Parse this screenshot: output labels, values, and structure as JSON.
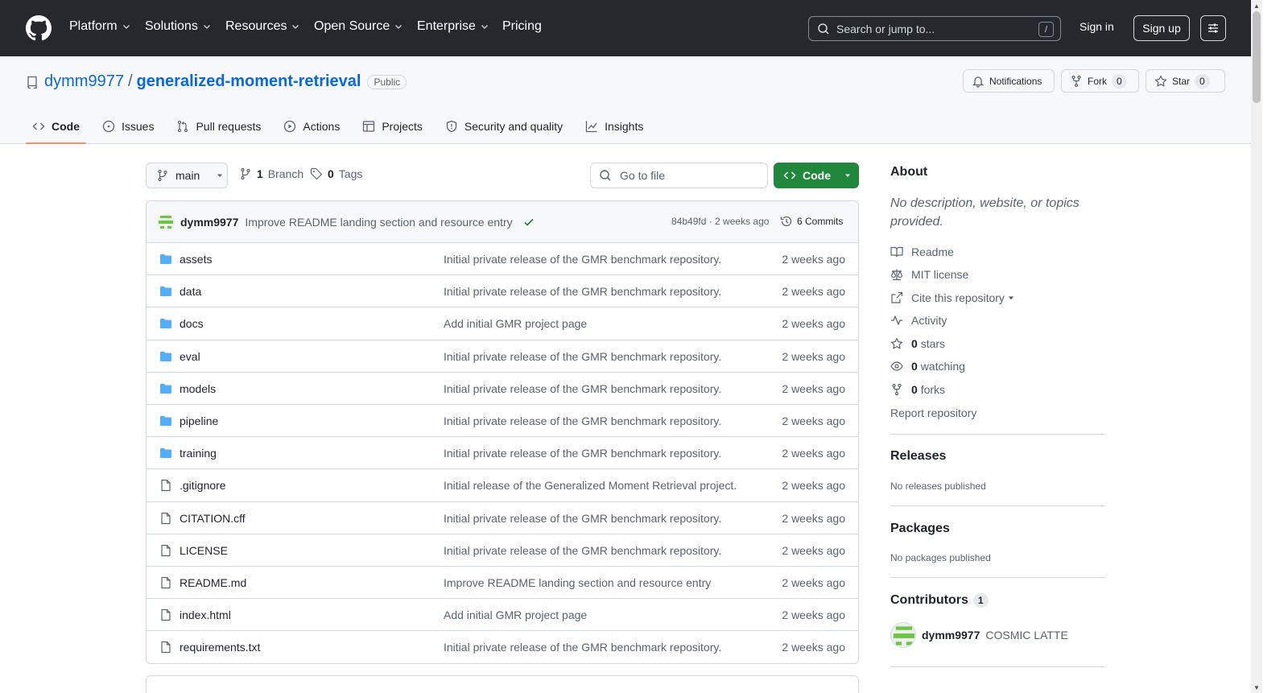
{
  "header": {
    "nav": [
      {
        "label": "Platform",
        "dropdown": true
      },
      {
        "label": "Solutions",
        "dropdown": true
      },
      {
        "label": "Resources",
        "dropdown": true
      },
      {
        "label": "Open Source",
        "dropdown": true
      },
      {
        "label": "Enterprise",
        "dropdown": true
      },
      {
        "label": "Pricing",
        "dropdown": false
      }
    ],
    "search_placeholder": "Search or jump to...",
    "search_shortcut": "/",
    "sign_in": "Sign in",
    "sign_up": "Sign up"
  },
  "repo": {
    "owner": "dymm9977",
    "separator": "/",
    "name": "generalized-moment-retrieval",
    "visibility": "Public",
    "notifications_label": "Notifications",
    "fork_label": "Fork",
    "fork_count": "0",
    "star_label": "Star",
    "star_count": "0"
  },
  "tabs": [
    {
      "label": "Code",
      "icon": "code-icon",
      "active": true
    },
    {
      "label": "Issues",
      "icon": "issue-icon",
      "active": false
    },
    {
      "label": "Pull requests",
      "icon": "pull-request-icon",
      "active": false
    },
    {
      "label": "Actions",
      "icon": "play-icon",
      "active": false
    },
    {
      "label": "Projects",
      "icon": "table-icon",
      "active": false
    },
    {
      "label": "Security and quality",
      "icon": "shield-icon",
      "active": false
    },
    {
      "label": "Insights",
      "icon": "graph-icon",
      "active": false
    }
  ],
  "toolbar": {
    "branch": "main",
    "branch_count": "1",
    "branch_label": "Branch",
    "tag_count": "0",
    "tag_label": "Tags",
    "goto_placeholder": "Go to file",
    "code_button": "Code"
  },
  "latest_commit": {
    "author": "dymm9977",
    "message": "Improve README landing section and resource entry",
    "hash_time": "84b49fd · 2 weeks ago",
    "commits_label": "6 Commits"
  },
  "files": [
    {
      "name": "assets",
      "type": "folder",
      "message": "Initial private release of the GMR benchmark repository.",
      "time": "2 weeks ago"
    },
    {
      "name": "data",
      "type": "folder",
      "message": "Initial private release of the GMR benchmark repository.",
      "time": "2 weeks ago"
    },
    {
      "name": "docs",
      "type": "folder",
      "message": "Add initial GMR project page",
      "time": "2 weeks ago"
    },
    {
      "name": "eval",
      "type": "folder",
      "message": "Initial private release of the GMR benchmark repository.",
      "time": "2 weeks ago"
    },
    {
      "name": "models",
      "type": "folder",
      "message": "Initial private release of the GMR benchmark repository.",
      "time": "2 weeks ago"
    },
    {
      "name": "pipeline",
      "type": "folder",
      "message": "Initial private release of the GMR benchmark repository.",
      "time": "2 weeks ago"
    },
    {
      "name": "training",
      "type": "folder",
      "message": "Initial private release of the GMR benchmark repository.",
      "time": "2 weeks ago"
    },
    {
      "name": ".gitignore",
      "type": "file",
      "message": "Initial release of the Generalized Moment Retrieval project.",
      "time": "2 weeks ago"
    },
    {
      "name": "CITATION.cff",
      "type": "file",
      "message": "Initial private release of the GMR benchmark repository.",
      "time": "2 weeks ago"
    },
    {
      "name": "LICENSE",
      "type": "file",
      "message": "Initial private release of the GMR benchmark repository.",
      "time": "2 weeks ago"
    },
    {
      "name": "README.md",
      "type": "file",
      "message": "Improve README landing section and resource entry",
      "time": "2 weeks ago"
    },
    {
      "name": "index.html",
      "type": "file",
      "message": "Add initial GMR project page",
      "time": "2 weeks ago"
    },
    {
      "name": "requirements.txt",
      "type": "file",
      "message": "Initial private release of the GMR benchmark repository.",
      "time": "2 weeks ago"
    }
  ],
  "sidebar": {
    "about_title": "About",
    "about_desc": "No description, website, or topics provided.",
    "readme": "Readme",
    "license": "MIT license",
    "cite": "Cite this repository",
    "activity": "Activity",
    "stars_count": "0",
    "stars_label": "stars",
    "watching_count": "0",
    "watching_label": "watching",
    "forks_count": "0",
    "forks_label": "forks",
    "report": "Report repository",
    "releases_title": "Releases",
    "releases_note": "No releases published",
    "packages_title": "Packages",
    "packages_note": "No packages published",
    "contributors_title": "Contributors",
    "contributors_count": "1",
    "contributor_user": "dymm9977",
    "contributor_name": "COSMIC LATTE"
  },
  "colors": {
    "header_bg": "#25292e",
    "link": "#0969da",
    "primary_button": "#1f883d",
    "folder_icon": "#54aeff",
    "active_tab_underline": "#fd8c73",
    "success": "#1a7f37"
  }
}
